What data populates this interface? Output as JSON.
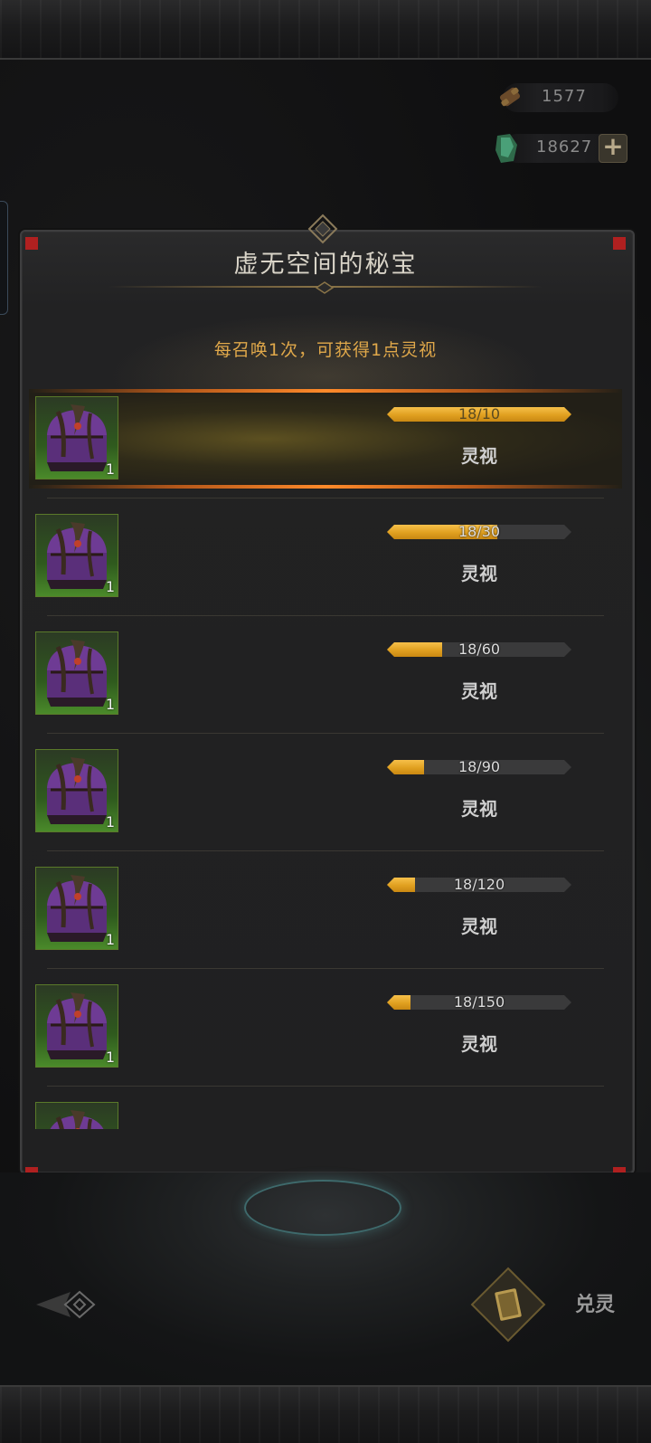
{
  "currency": {
    "scroll_amount": "1577",
    "gem_amount": "18627",
    "add_label": "+"
  },
  "panel": {
    "title": "虚无空间的秘宝",
    "subtitle": "每召唤1次，可获得1点灵视"
  },
  "rewards": [
    {
      "progress_text": "18/10",
      "current": 18,
      "target": 10,
      "reward_label": "灵视",
      "item_count": "1",
      "active": true
    },
    {
      "progress_text": "18/30",
      "current": 18,
      "target": 30,
      "reward_label": "灵视",
      "item_count": "1",
      "active": false
    },
    {
      "progress_text": "18/60",
      "current": 18,
      "target": 60,
      "reward_label": "灵视",
      "item_count": "1",
      "active": false
    },
    {
      "progress_text": "18/90",
      "current": 18,
      "target": 90,
      "reward_label": "灵视",
      "item_count": "1",
      "active": false
    },
    {
      "progress_text": "18/120",
      "current": 18,
      "target": 120,
      "reward_label": "灵视",
      "item_count": "1",
      "active": false
    },
    {
      "progress_text": "18/150",
      "current": 18,
      "target": 150,
      "reward_label": "灵视",
      "item_count": "1",
      "active": false
    }
  ],
  "bottom": {
    "exchange_label": "兑灵"
  },
  "icons": {
    "scroll": "scroll-icon",
    "gem": "green-gem-icon",
    "chest": "purple-chest-icon",
    "back": "back-arrow-icon",
    "exchange": "card-icon"
  },
  "colors": {
    "accent_gold": "#e0a84a",
    "progress_fill": "#e0a020",
    "item_border": "#5a7a2a"
  }
}
